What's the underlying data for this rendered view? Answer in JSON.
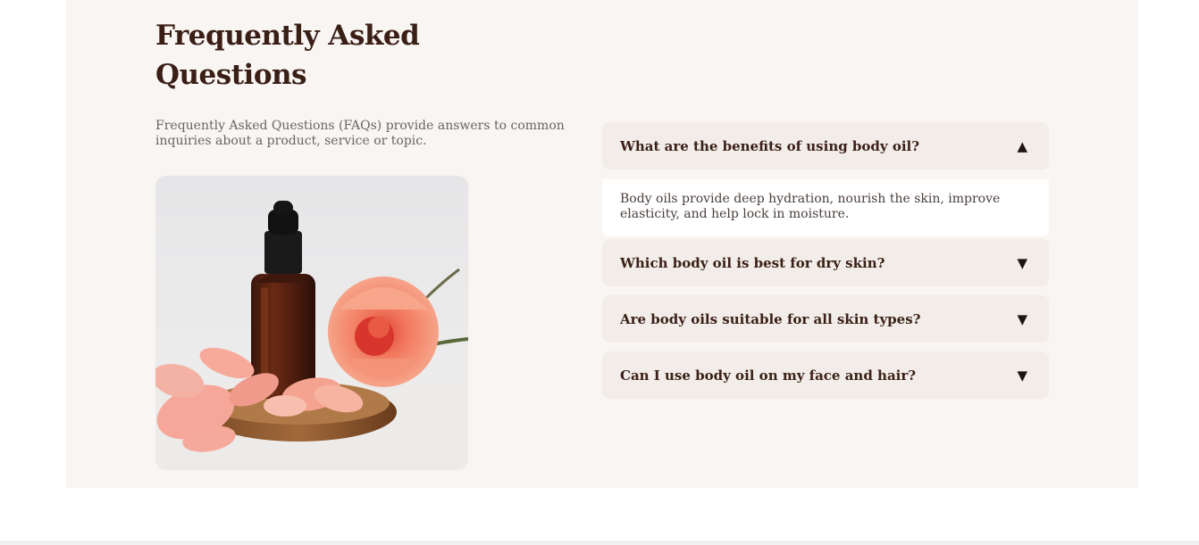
{
  "faq_section": {
    "title": "Frequently Asked Questions",
    "description": "Frequently Asked Questions (FAQs) provide answers to common inquiries about a product, service or topic.",
    "image_alt": "Amber dropper bottle of body oil with pink roses on a wooden dish",
    "items": [
      {
        "question": "What are the benefits of using body oil?",
        "answer": "Body oils provide deep hydration, nourish the skin, improve elasticity, and help lock in moisture.",
        "expanded": true,
        "arrow": "▲"
      },
      {
        "question": "Which body oil is best for dry skin?",
        "expanded": false,
        "arrow": "▼"
      },
      {
        "question": "Are body oils suitable for all skin types?",
        "expanded": false,
        "arrow": "▼"
      },
      {
        "question": "Can I use body oil on my face and hair?",
        "expanded": false,
        "arrow": "▼"
      }
    ]
  },
  "colors": {
    "section_background": "#f8f5f2",
    "question_background": "#f2ede8",
    "heading": "#3a1f17",
    "body_text": "#6b6461"
  }
}
